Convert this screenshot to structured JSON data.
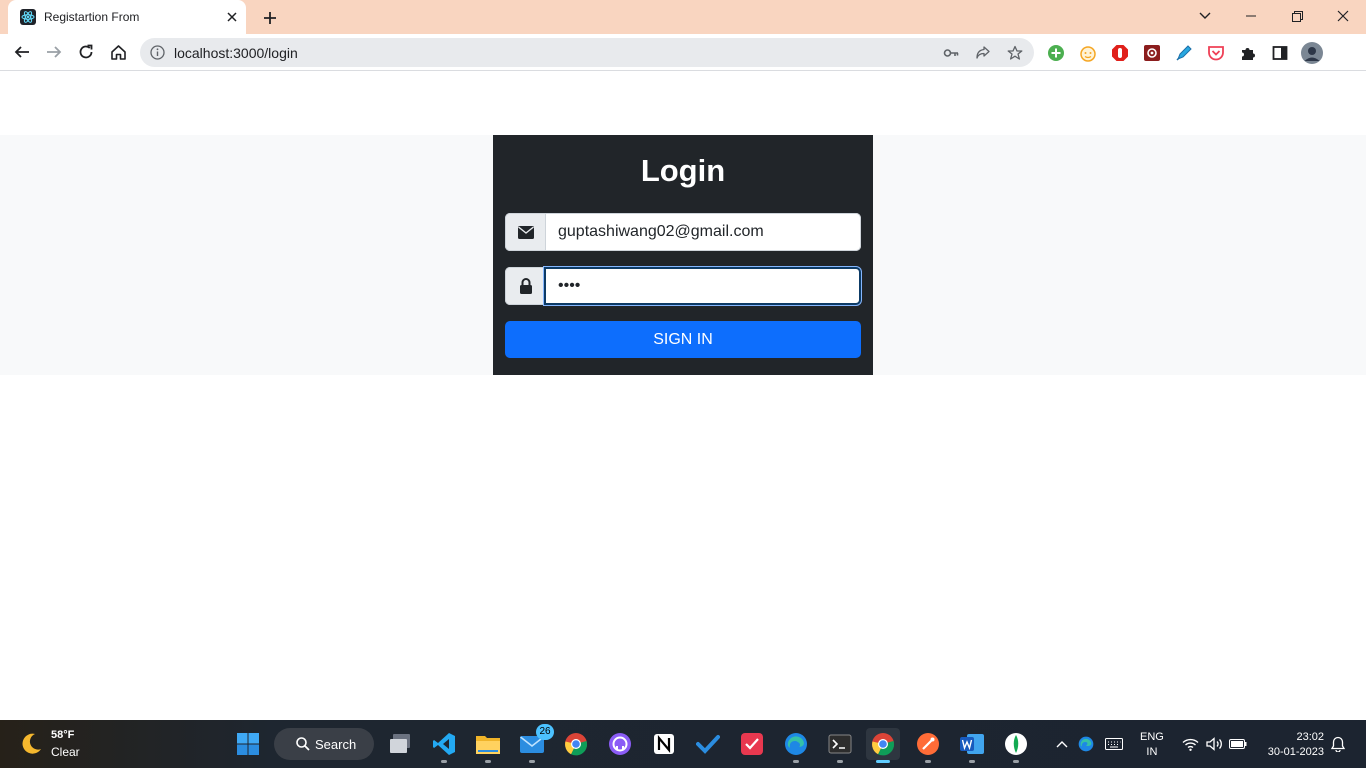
{
  "browser": {
    "tab_title": "Registartion From",
    "url": "localhost:3000/login"
  },
  "login": {
    "title": "Login",
    "email_value": "guptashiwang02@gmail.com",
    "password_value": "••••",
    "submit_label": "SIGN IN"
  },
  "taskbar": {
    "weather_temp": "58°F",
    "weather_condition": "Clear",
    "search_label": "Search",
    "mail_badge": "26",
    "lang_line1": "ENG",
    "lang_line2": "IN",
    "time": "23:02",
    "date": "30-01-2023"
  },
  "colors": {
    "tabstrip": "#f9d5c0",
    "card": "#212529",
    "primary": "#0d6efd",
    "band": "#f8f9fa"
  }
}
